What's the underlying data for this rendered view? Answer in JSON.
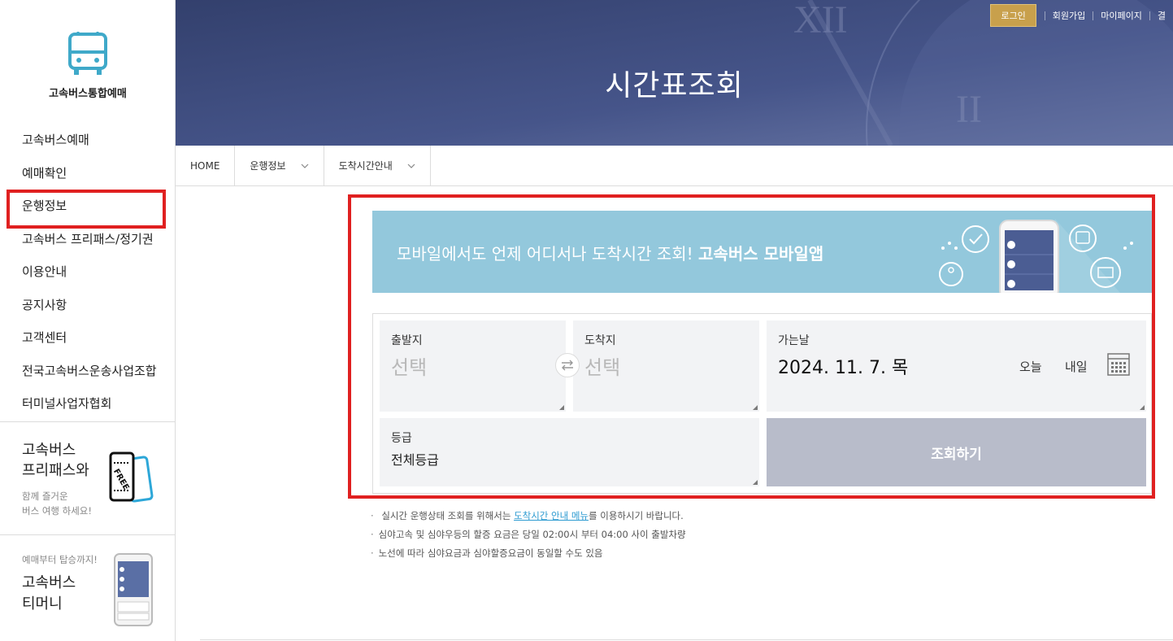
{
  "sidebar": {
    "brand": "고속버스통합예매",
    "items": [
      {
        "label": "고속버스예매"
      },
      {
        "label": "예매확인"
      },
      {
        "label": "운행정보"
      },
      {
        "label": "고속버스 프리패스/정기권"
      },
      {
        "label": "이용안내"
      },
      {
        "label": "공지사항"
      },
      {
        "label": "고객센터"
      },
      {
        "label": "전국고속버스운송사업조합"
      },
      {
        "label": "터미널사업자협회"
      }
    ],
    "promo_freepass": {
      "title_line1": "고속버스",
      "title_line2": "프리패스와",
      "sub_line1": "함께 즐거운",
      "sub_line2": "버스 여행 하세요!"
    },
    "promo_tmoney": {
      "sub": "예매부터 탑승까지!",
      "title_line1": "고속버스",
      "title_line2": "티머니"
    }
  },
  "header": {
    "title": "시간표조회",
    "login": "로그인",
    "links": [
      "회원가입",
      "마이페이지",
      "결"
    ]
  },
  "breadcrumb": {
    "home": "HOME",
    "level1": "운행정보",
    "level2": "도착시간안내"
  },
  "app_banner": {
    "text": "모바일에서도 언제 어디서나 도착시간 조회! ",
    "bold": "고속버스 모바일앱"
  },
  "form": {
    "departure_label": "출발지",
    "departure_value": "선택",
    "arrival_label": "도착지",
    "arrival_value": "선택",
    "date_label": "가는날",
    "date_value": "2024. 11. 7. 목",
    "today": "오늘",
    "tomorrow": "내일",
    "grade_label": "등급",
    "grade_value": "전체등급",
    "search_button": "조회하기"
  },
  "notes": {
    "n1_pre": "실시간 운행상태 조회를 위해서는 ",
    "n1_link": "도착시간 안내 메뉴",
    "n1_post": "를 이용하시기 바랍니다.",
    "n2": "심야고속 및 심야우등의 할증 요금은 당일 02:00시 부터 04:00 사이 출발차량",
    "n3": "노선에 따라 심야요금과 심야할증요금이 동일할 수도 있음"
  },
  "colors": {
    "accent": "#93c8dc",
    "login": "#c8a04c",
    "highlight": "#e02020",
    "button": "#b8bcca"
  }
}
